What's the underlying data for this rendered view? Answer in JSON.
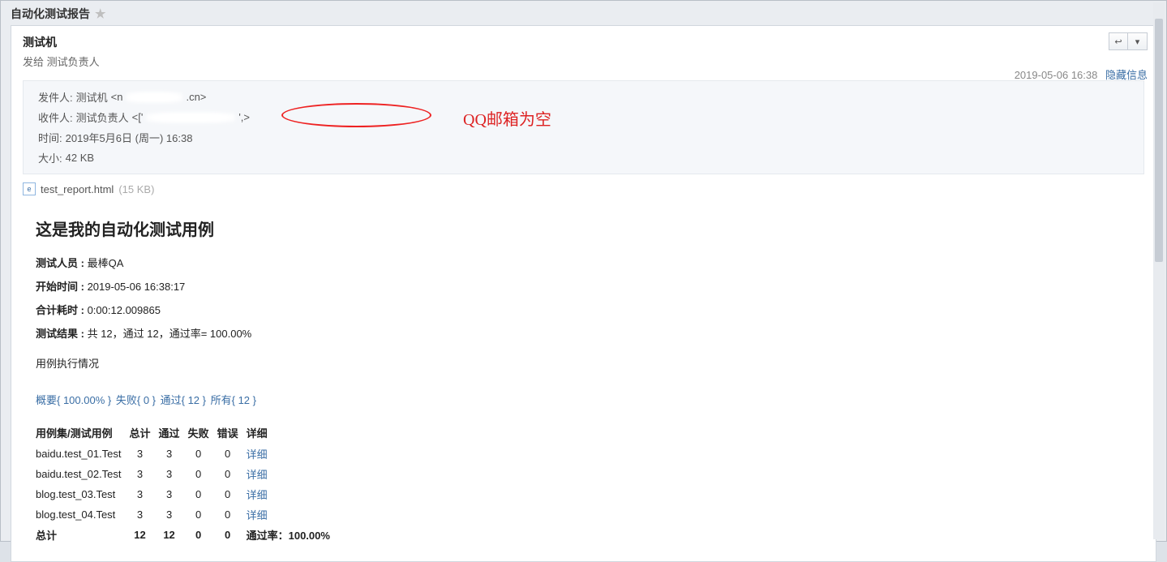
{
  "title": "自动化测试报告",
  "panel": {
    "title": "测试机",
    "send_prefix": "发给",
    "send_to": "测试负责人",
    "datetime": "2019-05-06 16:38",
    "hide_link": "隐藏信息"
  },
  "info": {
    "from_label": "发件人:",
    "from_name": "测试机",
    "from_suffix": ".cn>",
    "from_lt": "<n",
    "to_label": "收件人:",
    "to_name": "测试负责人",
    "to_lt": "<['",
    "to_gt": "',>",
    "time_label": "时间:",
    "time_value": "2019年5月6日 (周一) 16:38",
    "size_label": "大小:",
    "size_value": "42 KB",
    "annotation": "QQ邮箱为空"
  },
  "attachment": {
    "icon_letter": "e",
    "name": "test_report.html",
    "size": "(15 KB)"
  },
  "content": {
    "heading": "这是我的自动化测试用例",
    "tester_label": "测试人员 :",
    "tester_value": "最棒QA",
    "start_label": "开始时间 :",
    "start_value": "2019-05-06 16:38:17",
    "elapsed_label": "合计耗时 :",
    "elapsed_value": "0:00:12.009865",
    "result_label": "测试结果 :",
    "result_value": "共 12，通过 12，通过率= 100.00%",
    "exec_title": "用例执行情况"
  },
  "summary_links": {
    "overview": "概要{ 100.00% }",
    "fail": "失败{ 0 }",
    "pass": "通过{ 12 }",
    "all": "所有{ 12 }"
  },
  "table": {
    "headers": {
      "suite": "用例集/测试用例",
      "total": "总计",
      "pass": "通过",
      "fail": "失败",
      "error": "错误",
      "detail": "详细"
    },
    "rows": [
      {
        "name": "baidu.test_01.Test",
        "total": "3",
        "pass": "3",
        "fail": "0",
        "error": "0",
        "detail": "详细"
      },
      {
        "name": "baidu.test_02.Test",
        "total": "3",
        "pass": "3",
        "fail": "0",
        "error": "0",
        "detail": "详细"
      },
      {
        "name": "blog.test_03.Test",
        "total": "3",
        "pass": "3",
        "fail": "0",
        "error": "0",
        "detail": "详细"
      },
      {
        "name": "blog.test_04.Test",
        "total": "3",
        "pass": "3",
        "fail": "0",
        "error": "0",
        "detail": "详细"
      }
    ],
    "total_row": {
      "label": "总计",
      "total": "12",
      "pass": "12",
      "fail": "0",
      "error": "0",
      "passrate_label": "通过率：",
      "passrate_value": "100.00%"
    }
  }
}
